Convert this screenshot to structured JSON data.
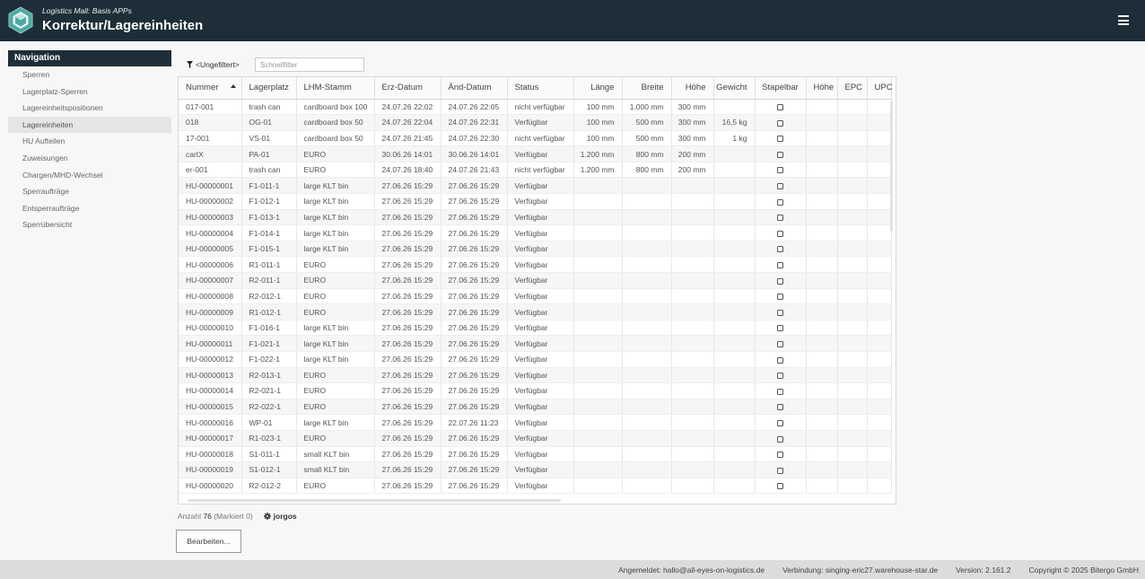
{
  "header": {
    "subtitle": "Logistics Mall: Basis APPs",
    "title": "Korrektur/Lagereinheiten"
  },
  "nav": {
    "heading": "Navigation",
    "items": [
      {
        "label": "Sperren"
      },
      {
        "label": "Lagerplatz-Sperren"
      },
      {
        "label": "Lagereinheitspositionen"
      },
      {
        "label": "Lagereinheiten",
        "active": true
      },
      {
        "label": "HU Aufteilen"
      },
      {
        "label": "Zuweisungen"
      },
      {
        "label": "Chargen/MHD-Wechsel"
      },
      {
        "label": "Sperraufträge"
      },
      {
        "label": "Entsperraufträge"
      },
      {
        "label": "Sperrübersicht"
      }
    ]
  },
  "filter": {
    "label": "<Ungefiltert>",
    "quick_placeholder": "Schnellfilter",
    "quick_value": ""
  },
  "table": {
    "columns": [
      "Nummer",
      "Lagerplatz",
      "LHM-Stamm",
      "Erz-Datum",
      "Änd-Datum",
      "Status",
      "Länge",
      "Breite",
      "Höhe",
      "Gewicht",
      "Stapelbar",
      "Höhe",
      "EPC",
      "UPC"
    ],
    "sorted_column": "Nummer",
    "rows": [
      [
        "017-001",
        "trash can",
        "cardboard box 100",
        "24.07.26 22:02",
        "24.07.26 22:05",
        "nicht verfügbar",
        "100 mm",
        "1.000 mm",
        "300 mm",
        "",
        "",
        "",
        "",
        ""
      ],
      [
        "018",
        "OG-01",
        "cardboard box 50",
        "24.07.26 22:04",
        "24.07.26 22:31",
        "Verfügbar",
        "100 mm",
        "500 mm",
        "300 mm",
        "16,5 kg",
        "",
        "",
        "",
        ""
      ],
      [
        "17-001",
        "VS-01",
        "cardboard box 50",
        "24.07.26 21:45",
        "24.07.26 22:30",
        "nicht verfügbar",
        "100 mm",
        "500 mm",
        "300 mm",
        "1 kg",
        "",
        "",
        "",
        ""
      ],
      [
        "cartX",
        "PA-01",
        "EURO",
        "30.06.26 14:01",
        "30.06.26 14:01",
        "Verfügbar",
        "1.200 mm",
        "800 mm",
        "200 mm",
        "",
        "",
        "",
        "",
        ""
      ],
      [
        "er-001",
        "trash can",
        "EURO",
        "24.07.26 18:40",
        "24.07.26 21:43",
        "nicht verfügbar",
        "1.200 mm",
        "800 mm",
        "200 mm",
        "",
        "",
        "",
        "",
        ""
      ],
      [
        "HU-00000001",
        "F1-011-1",
        "large KLT bin",
        "27.06.26 15:29",
        "27.06.26 15:29",
        "Verfügbar",
        "",
        "",
        "",
        "",
        "",
        "",
        "",
        ""
      ],
      [
        "HU-00000002",
        "F1-012-1",
        "large KLT bin",
        "27.06.26 15:29",
        "27.06.26 15:29",
        "Verfügbar",
        "",
        "",
        "",
        "",
        "",
        "",
        "",
        ""
      ],
      [
        "HU-00000003",
        "F1-013-1",
        "large KLT bin",
        "27.06.26 15:29",
        "27.06.26 15:29",
        "Verfügbar",
        "",
        "",
        "",
        "",
        "",
        "",
        "",
        ""
      ],
      [
        "HU-00000004",
        "F1-014-1",
        "large KLT bin",
        "27.06.26 15:29",
        "27.06.26 15:29",
        "Verfügbar",
        "",
        "",
        "",
        "",
        "",
        "",
        "",
        ""
      ],
      [
        "HU-00000005",
        "F1-015-1",
        "large KLT bin",
        "27.06.26 15:29",
        "27.06.26 15:29",
        "Verfügbar",
        "",
        "",
        "",
        "",
        "",
        "",
        "",
        ""
      ],
      [
        "HU-00000006",
        "R1-011-1",
        "EURO",
        "27.06.26 15:29",
        "27.06.26 15:29",
        "Verfügbar",
        "",
        "",
        "",
        "",
        "",
        "",
        "",
        ""
      ],
      [
        "HU-00000007",
        "R2-011-1",
        "EURO",
        "27.06.26 15:29",
        "27.06.26 15:29",
        "Verfügbar",
        "",
        "",
        "",
        "",
        "",
        "",
        "",
        ""
      ],
      [
        "HU-00000008",
        "R2-012-1",
        "EURO",
        "27.06.26 15:29",
        "27.06.26 15:29",
        "Verfügbar",
        "",
        "",
        "",
        "",
        "",
        "",
        "",
        ""
      ],
      [
        "HU-00000009",
        "R1-012-1",
        "EURO",
        "27.06.26 15:29",
        "27.06.26 15:29",
        "Verfügbar",
        "",
        "",
        "",
        "",
        "",
        "",
        "",
        ""
      ],
      [
        "HU-00000010",
        "F1-016-1",
        "large KLT bin",
        "27.06.26 15:29",
        "27.06.26 15:29",
        "Verfügbar",
        "",
        "",
        "",
        "",
        "",
        "",
        "",
        ""
      ],
      [
        "HU-00000011",
        "F1-021-1",
        "large KLT bin",
        "27.06.26 15:29",
        "27.06.26 15:29",
        "Verfügbar",
        "",
        "",
        "",
        "",
        "",
        "",
        "",
        ""
      ],
      [
        "HU-00000012",
        "F1-022-1",
        "large KLT bin",
        "27.06.26 15:29",
        "27.06.26 15:29",
        "Verfügbar",
        "",
        "",
        "",
        "",
        "",
        "",
        "",
        ""
      ],
      [
        "HU-00000013",
        "R2-013-1",
        "EURO",
        "27.06.26 15:29",
        "27.06.26 15:29",
        "Verfügbar",
        "",
        "",
        "",
        "",
        "",
        "",
        "",
        ""
      ],
      [
        "HU-00000014",
        "R2-021-1",
        "EURO",
        "27.06.26 15:29",
        "27.06.26 15:29",
        "Verfügbar",
        "",
        "",
        "",
        "",
        "",
        "",
        "",
        ""
      ],
      [
        "HU-00000015",
        "R2-022-1",
        "EURO",
        "27.06.26 15:29",
        "27.06.26 15:29",
        "Verfügbar",
        "",
        "",
        "",
        "",
        "",
        "",
        "",
        ""
      ],
      [
        "HU-00000016",
        "WP-01",
        "large KLT bin",
        "27.06.26 15:29",
        "22.07.26 11:23",
        "Verfügbar",
        "",
        "",
        "",
        "",
        "",
        "",
        "",
        ""
      ],
      [
        "HU-00000017",
        "R1-023-1",
        "EURO",
        "27.06.26 15:29",
        "27.06.26 15:29",
        "Verfügbar",
        "",
        "",
        "",
        "",
        "",
        "",
        "",
        ""
      ],
      [
        "HU-00000018",
        "S1-011-1",
        "small KLT bin",
        "27.06.26 15:29",
        "27.06.26 15:29",
        "Verfügbar",
        "",
        "",
        "",
        "",
        "",
        "",
        "",
        ""
      ],
      [
        "HU-00000019",
        "S1-012-1",
        "small KLT bin",
        "27.06.26 15:29",
        "27.06.26 15:29",
        "Verfügbar",
        "",
        "",
        "",
        "",
        "",
        "",
        "",
        ""
      ],
      [
        "HU-00000020",
        "R2-012-2",
        "EURO",
        "27.06.26 15:29",
        "27.06.26 15:29",
        "Verfügbar",
        "",
        "",
        "",
        "",
        "",
        "",
        "",
        ""
      ]
    ]
  },
  "summary": {
    "count_label": "Anzahl",
    "count": "76",
    "marked": "(Markiert 0)",
    "user": "jorgos"
  },
  "edit_button": "Bearbeiten...",
  "footer": {
    "logged_in": "Angemeldet: hallo@all-eyes-on-logistics.de",
    "connection": "Verbindung: singing-eric27.warehouse-star.de",
    "version": "Version: 2.161.2",
    "copyright": "Copyright © 2025 Bitergo GmbH"
  },
  "colors": {
    "header_bg": "#1e2e38",
    "logo_teal": "#4fa8a0"
  },
  "icons": {
    "logo": "hexagon-logo-icon",
    "menu": "hamburger-menu-icon",
    "filter": "filter-funnel-icon",
    "user": "gear-icon",
    "checkbox": "checkbox-icon"
  }
}
